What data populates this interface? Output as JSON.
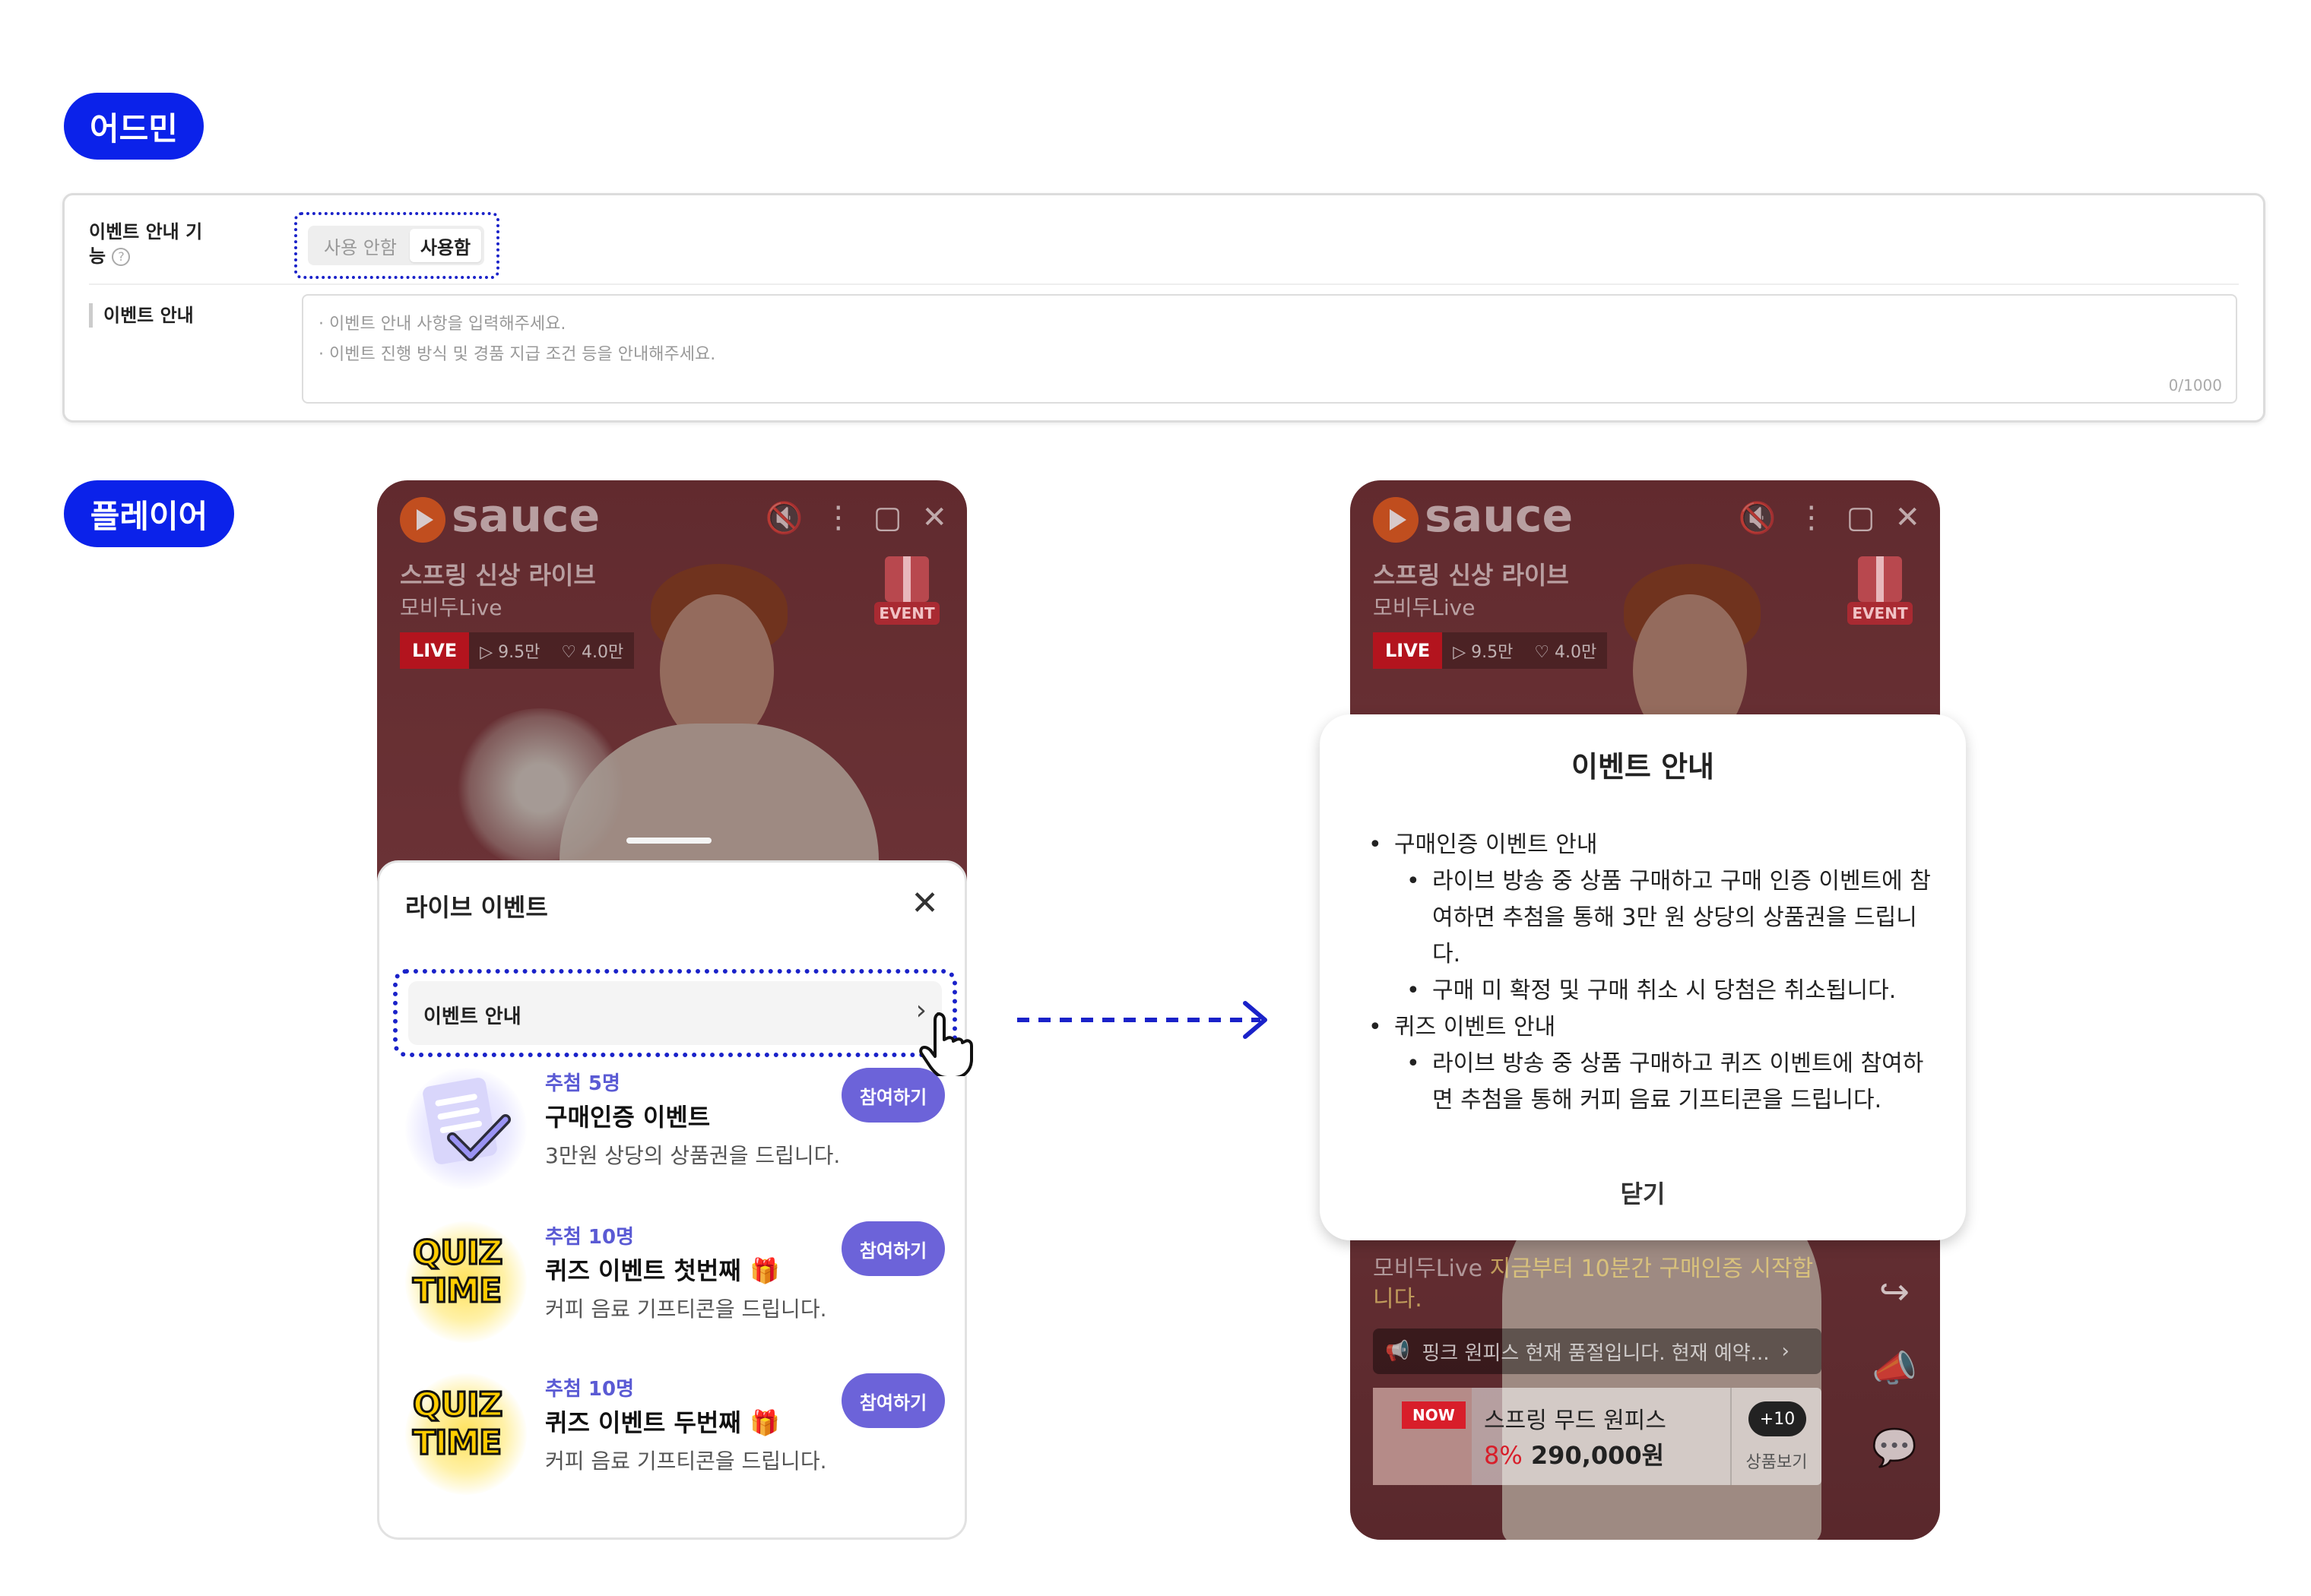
{
  "labels": {
    "admin": "어드민",
    "player": "플레이어"
  },
  "admin": {
    "feature_label": "이벤트 안내 기능",
    "help_icon": "?",
    "toggle": {
      "off": "사용 안함",
      "on": "사용함"
    },
    "notice_label": "이벤트 안내",
    "placeholder_line1": "· 이벤트 안내 사항을 입력해주세요.",
    "placeholder_line2": "· 이벤트 진행 방식 및 경품 지급 조건 등을 안내해주세요.",
    "char_count": "0/1000"
  },
  "player": {
    "logo": "sauce",
    "icons": [
      "mute-icon",
      "more-icon",
      "pip-icon",
      "close-icon"
    ],
    "title": "스프링 신상 라이브",
    "subtitle": "모비두Live",
    "live": "LIVE",
    "views": "▷ 9.5만",
    "likes": "♡ 4.0만",
    "event_tag": "EVENT"
  },
  "sheet": {
    "title": "라이브 이벤트",
    "notice_row": "이벤트 안내",
    "events": [
      {
        "winners": "추첨 5명",
        "name": "구매인증 이벤트",
        "desc": "3만원 상당의 상품권을 드립니다.",
        "button": "참여하기"
      },
      {
        "winners": "추첨 10명",
        "name": "퀴즈 이벤트 첫번째 🎁",
        "desc": "커피 음료 기프티콘을 드립니다.",
        "button": "참여하기"
      },
      {
        "winners": "추첨 10명",
        "name": "퀴즈 이벤트 두번째 🎁",
        "desc": "커피 음료 기프티콘을 드립니다.",
        "button": "참여하기"
      }
    ],
    "quiz_word1": "QUIZ",
    "quiz_word2": "TIME"
  },
  "modal": {
    "title": "이벤트 안내",
    "item1": "구매인증 이벤트 안내",
    "item1_sub1": "라이브 방송 중 상품 구매하고 구매 인증 이벤트에 참여하면 추첨을 통해 3만 원 상당의 상품권을 드립니다.",
    "item1_sub2": "구매 미 확정 및 구매 취소 시 당첨은 취소됩니다.",
    "item2": "퀴즈 이벤트 안내",
    "item2_sub1": "라이브 방송 중 상품 구매하고 퀴즈 이벤트에 참여하면 추첨을 통해 커피 음료 기프티콘을 드립니다.",
    "close": "닫기"
  },
  "right_player": {
    "chat_user": "모비두Live",
    "chat_text": "지금부터 10분간 구매인증 시작합니다.",
    "pinned": "핑크 원피스 현재 품절입니다. 현재 예약...",
    "product_badge": "NOW",
    "product_name": "스프링 무드 원피스",
    "product_discount": "8%",
    "product_price": "290,000원",
    "more_count": "+10",
    "more_label": "상품보기"
  }
}
